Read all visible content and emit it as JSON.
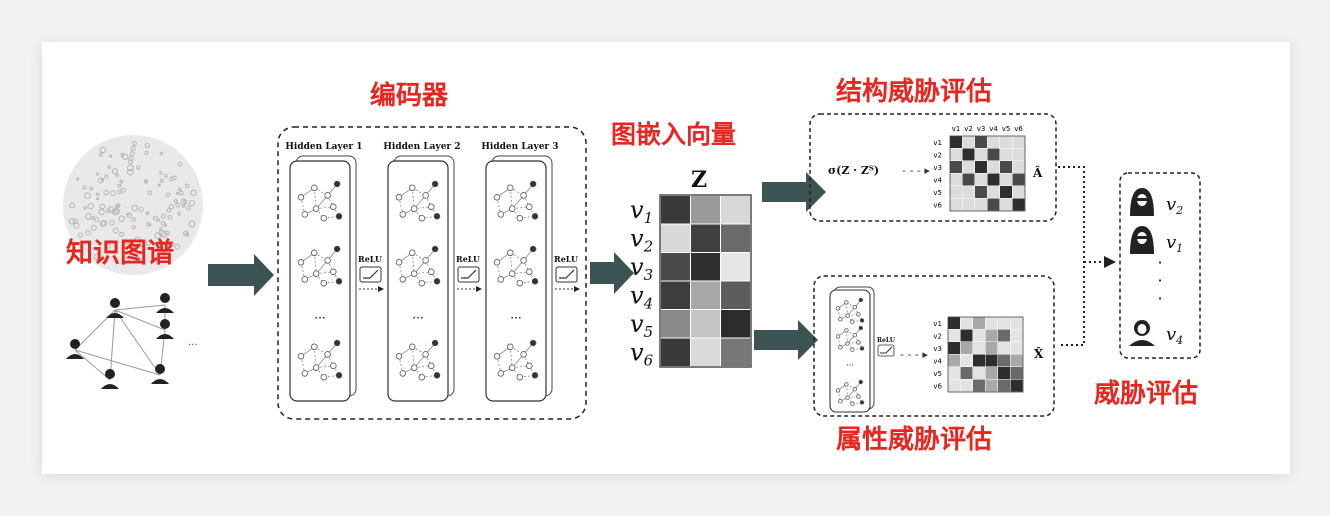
{
  "labels": {
    "knowledge_graph": "知识图谱",
    "encoder": "编码器",
    "embedding": "图嵌入向量",
    "structure_threat": "结构威胁评估",
    "attribute_threat": "属性威胁评估",
    "threat_assessment": "威胁评估"
  },
  "encoder": {
    "layers": [
      "Hidden Layer 1",
      "Hidden Layer 2",
      "Hidden Layer 3"
    ],
    "relu": "ReLU",
    "ellipsis": "···"
  },
  "embedding": {
    "title": "Z",
    "rows": [
      {
        "label": "v",
        "sub": "1"
      },
      {
        "label": "v",
        "sub": "2"
      },
      {
        "label": "v",
        "sub": "3"
      },
      {
        "label": "v",
        "sub": "4"
      },
      {
        "label": "v",
        "sub": "5"
      },
      {
        "label": "v",
        "sub": "6"
      }
    ]
  },
  "structure": {
    "formula": "σ(Z · Zᵀ)",
    "dashes": "- - - ▸",
    "col_labels": [
      "v1",
      "v2",
      "v3",
      "v4",
      "v5",
      "v6"
    ],
    "row_labels": [
      "v1",
      "v2",
      "v3",
      "v4",
      "v5",
      "v6"
    ],
    "output": "Â"
  },
  "attribute": {
    "relu": "ReLU",
    "dashes": "- - - ▸",
    "row_labels": [
      "v1",
      "v2",
      "v3",
      "v4",
      "v5",
      "v6"
    ],
    "output": "X̂"
  },
  "ranking": {
    "items": [
      {
        "label": "v",
        "sub": "2"
      },
      {
        "label": "v",
        "sub": "1"
      },
      {
        "label": "v",
        "sub": "4"
      }
    ],
    "dots": "·"
  },
  "colors": {
    "accent_red": "#e8261f",
    "arrow": "#3c5353"
  }
}
